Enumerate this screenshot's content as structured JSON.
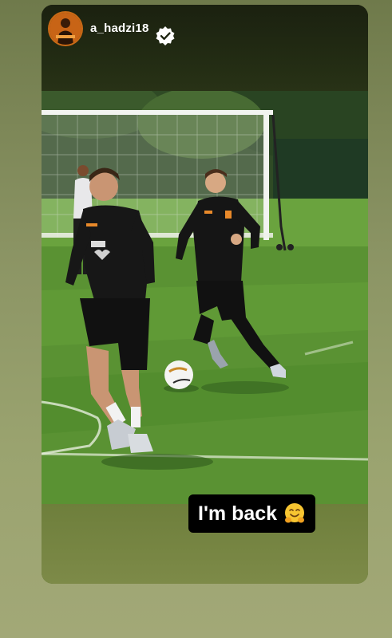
{
  "story": {
    "username": "a_hadzi18",
    "verified_icon": "verified-badge-icon",
    "caption_text": "I'm back",
    "caption_emoji": "hugging-face-emoji"
  },
  "colors": {
    "caption_bg": "#000000",
    "caption_text": "#ffffff",
    "kit_black": "#111111",
    "kit_orange": "#e8892a",
    "pitch_green": "#4f8a2c"
  }
}
